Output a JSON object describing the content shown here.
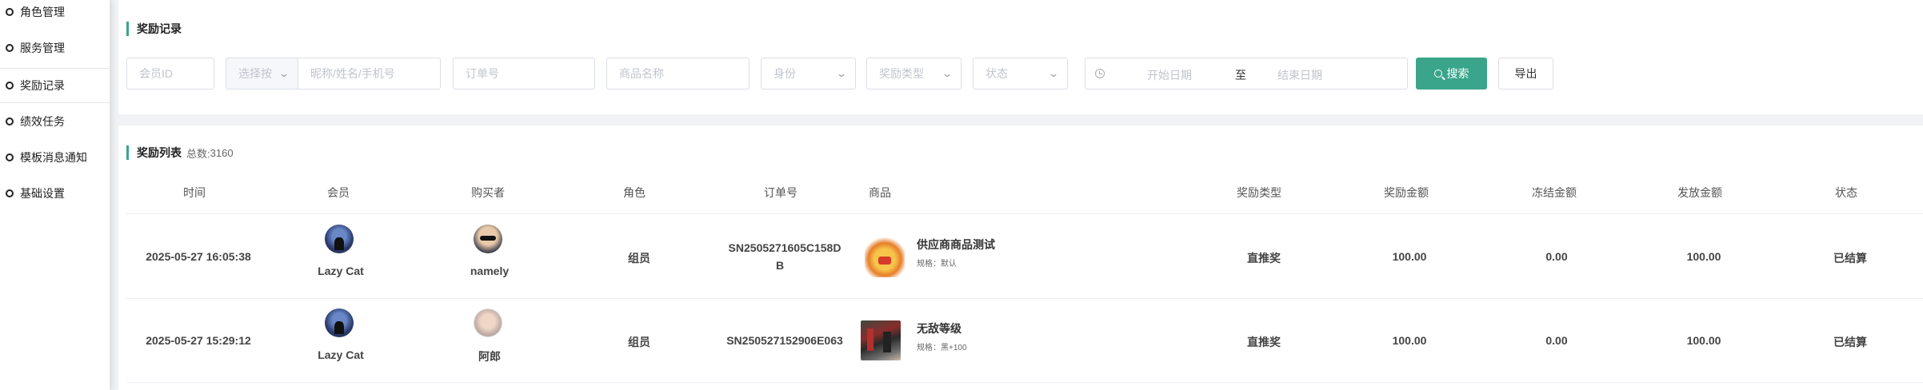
{
  "sidebar": {
    "items": [
      {
        "label": "角色管理"
      },
      {
        "label": "服务管理"
      },
      {
        "label": "奖励记录"
      },
      {
        "label": "绩效任务"
      },
      {
        "label": "模板消息通知"
      },
      {
        "label": "基础设置"
      }
    ]
  },
  "filter": {
    "title": "奖励记录",
    "member_id_placeholder": "会员ID",
    "select_by": "选择按",
    "name_placeholder": "昵称/姓名/手机号",
    "order_placeholder": "订单号",
    "product_placeholder": "商品名称",
    "identity": "身份",
    "reward_type": "奖励类型",
    "status": "状态",
    "start_date": "开始日期",
    "date_sep": "至",
    "end_date": "结束日期",
    "search_label": "搜索",
    "export_label": "导出",
    "accent_color": "#3aa58a"
  },
  "list": {
    "title": "奖励列表",
    "count_label": "总数:",
    "count": "3160",
    "columns": {
      "time": "时间",
      "member": "会员",
      "buyer": "购买者",
      "role": "角色",
      "order": "订单号",
      "product": "商品",
      "reward_type": "奖励类型",
      "reward_amount": "奖励金额",
      "frozen_amount": "冻结金额",
      "paid_amount": "发放金额",
      "status": "状态"
    },
    "rows": [
      {
        "time": "2025-05-27 16:05:38",
        "member": "Lazy Cat",
        "buyer": "namely",
        "role": "组员",
        "order_line1": "SN2505271605C158D",
        "order_line2": "B",
        "product_name": "供应商商品测试",
        "product_spec": "规格：默认",
        "reward_type": "直推奖",
        "reward_amount": "100.00",
        "frozen_amount": "0.00",
        "paid_amount": "100.00",
        "status": "已结算"
      },
      {
        "time": "2025-05-27 15:29:12",
        "member": "Lazy Cat",
        "buyer": "阿郎",
        "role": "组员",
        "order_line1": "SN250527152906E063",
        "product_name": "无敌等级",
        "product_spec": "规格：黑+100",
        "reward_type": "直推奖",
        "reward_amount": "100.00",
        "frozen_amount": "0.00",
        "paid_amount": "100.00",
        "status": "已结算"
      }
    ]
  }
}
